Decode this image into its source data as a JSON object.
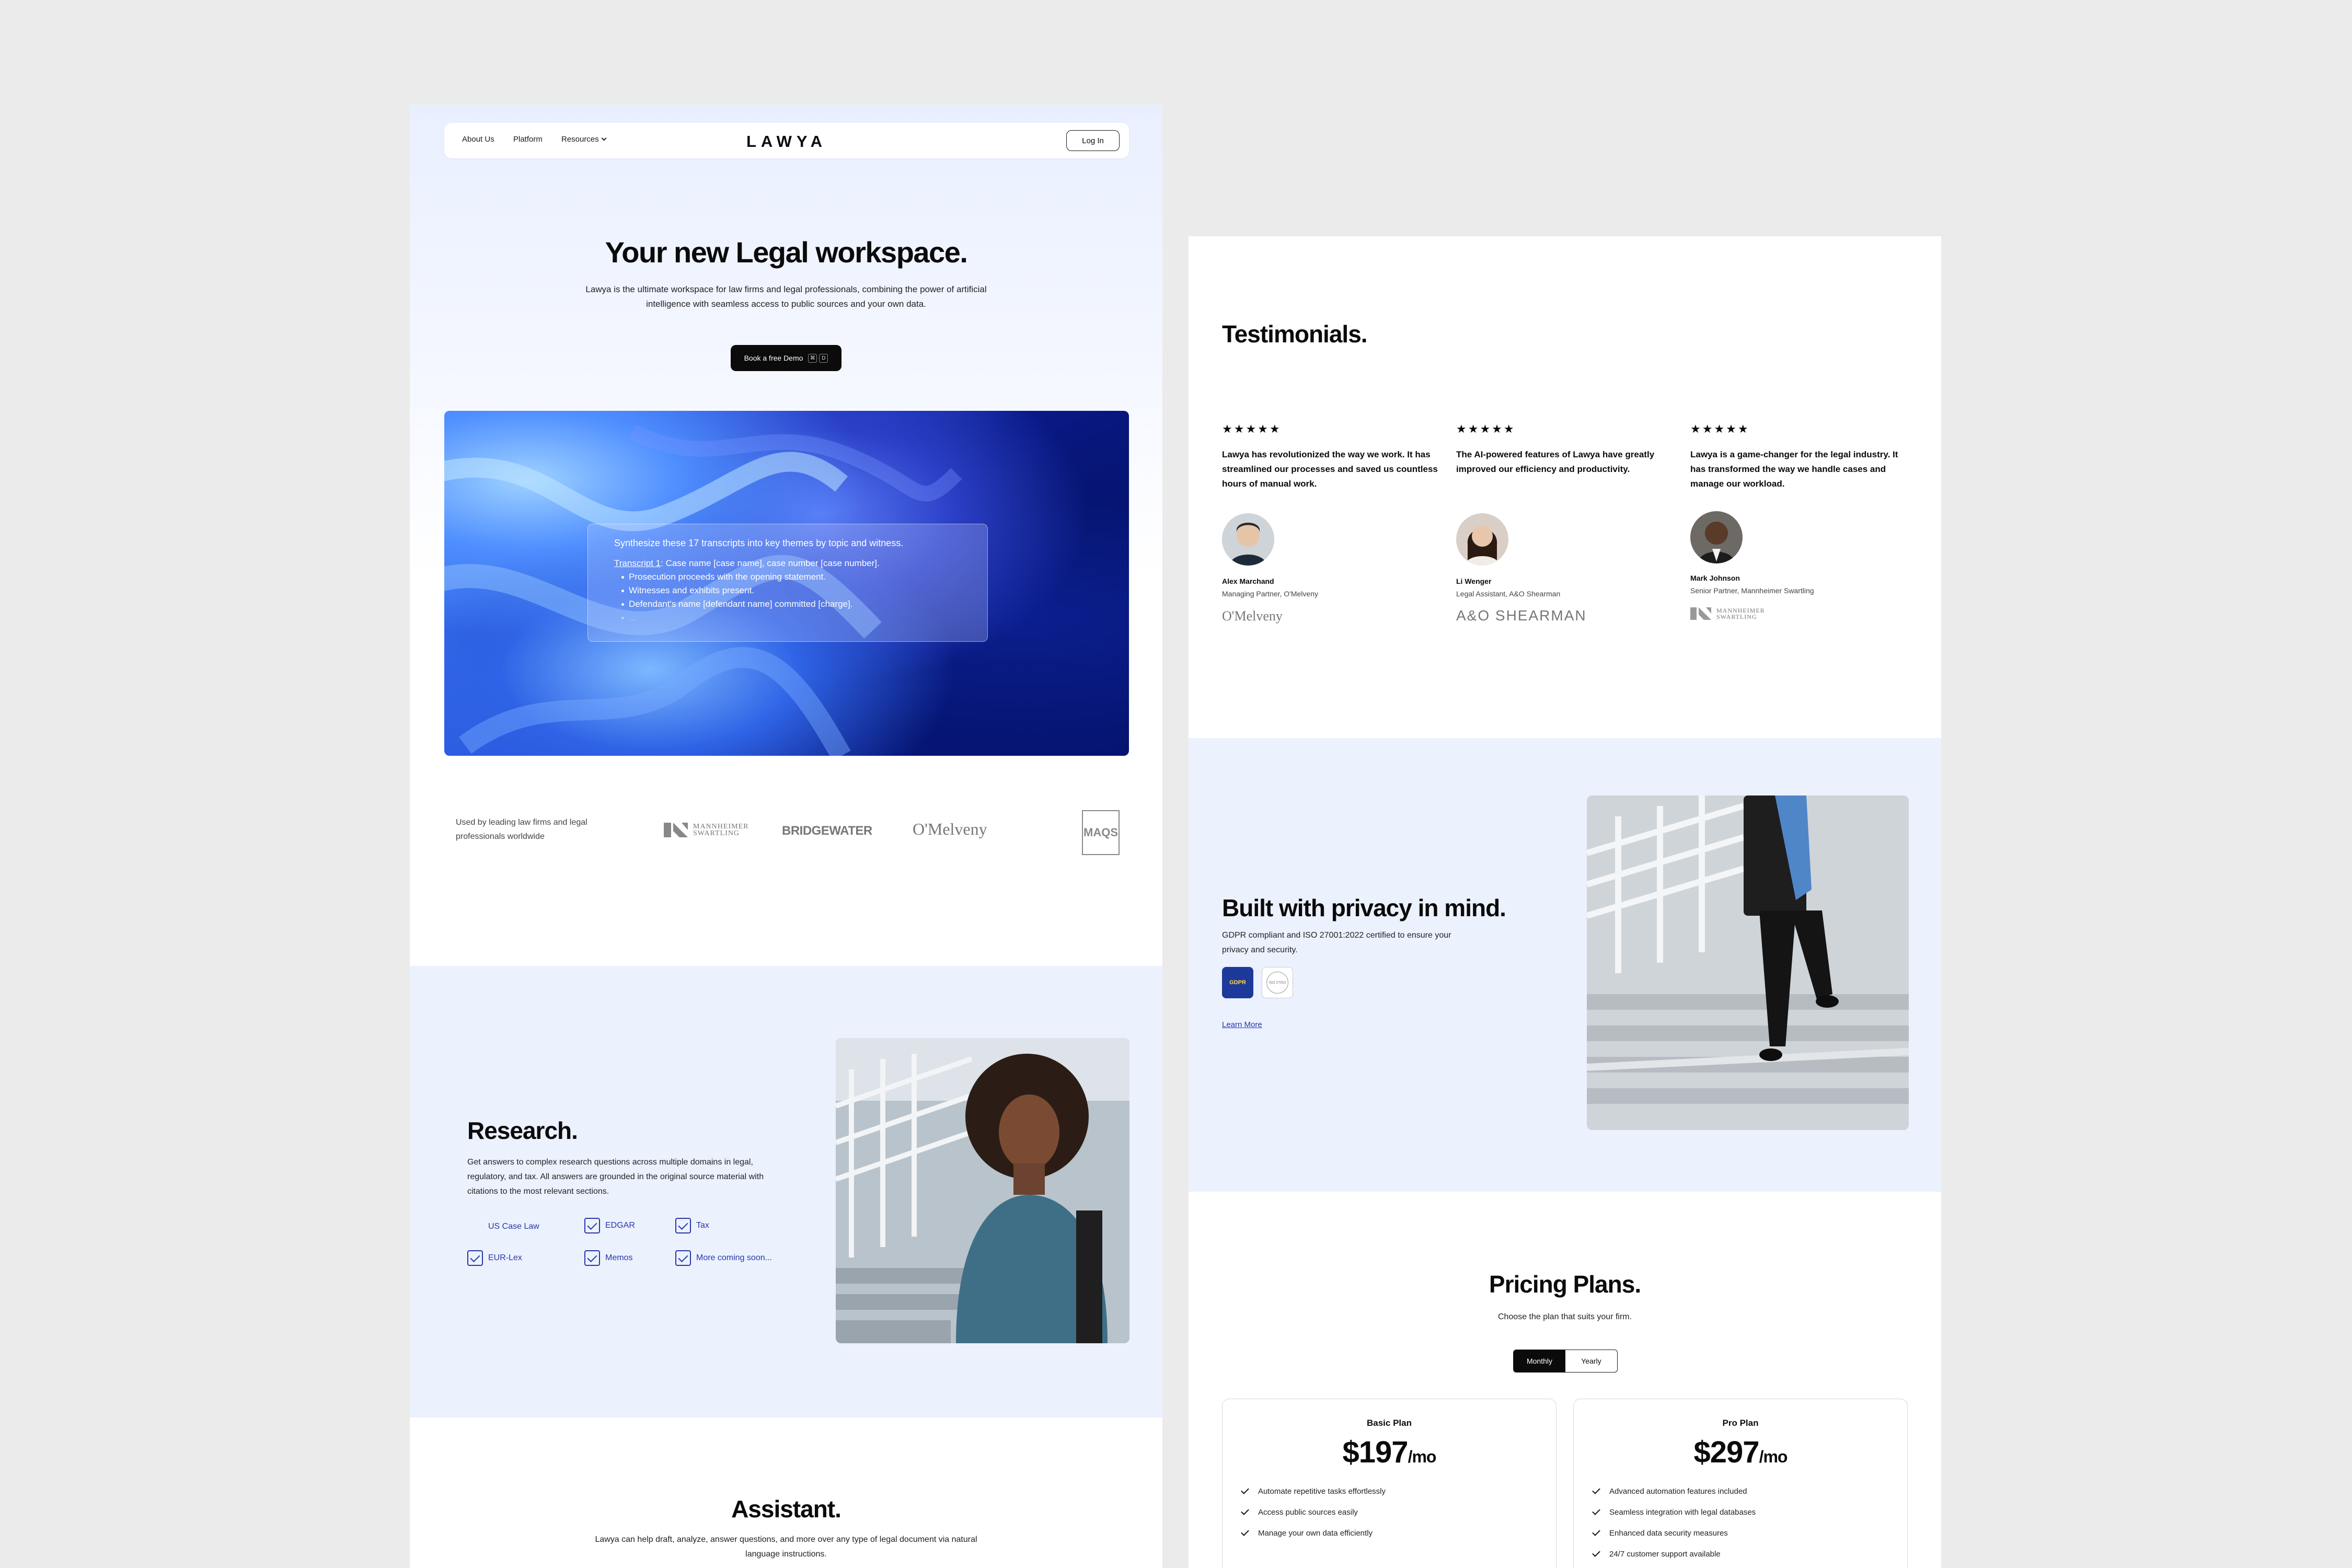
{
  "nav": {
    "links": [
      "About Us",
      "Platform",
      "Resources"
    ],
    "logo": "LAWYA",
    "login": "Log In"
  },
  "hero": {
    "title": "Your new Legal workspace.",
    "subtitle": "Lawya is the ultimate workspace for law firms and legal professionals, combining the power of artificial intelligence with seamless access to public sources and your own data.",
    "cta": "Book a free Demo",
    "cta_keys": [
      "⌘",
      "D"
    ]
  },
  "prompt": {
    "question": "Synthesize these 17 transcripts into key themes by topic and witness.",
    "transcript_link": "Transcript 1",
    "transcript_rest": ": Case name [case name], case number [case number].",
    "bullets": [
      "Prosecution proceeds with the opening statement.",
      "Witnesses and exhibits present.",
      "Defendant's name [defendant name] committed [charge].",
      "..."
    ]
  },
  "partners": {
    "caption": "Used by leading law firms and legal professionals worldwide",
    "logos": [
      "MANNHEIMER SWARTLING",
      "BRIDGEWATER",
      "O'Melveny",
      "MAQS"
    ]
  },
  "research": {
    "title": "Research.",
    "text": "Get answers to complex research questions across multiple domains in legal, regulatory, and tax. All answers are grounded in the original source material with citations to the most relevant sections.",
    "sources": [
      "US Case Law",
      "EDGAR",
      "Tax",
      "EUR-Lex",
      "Memos",
      "More coming soon..."
    ]
  },
  "assistant": {
    "title": "Assistant.",
    "text": "Lawya can help draft, analyze, answer questions, and more over any type of legal document via natural language instructions."
  },
  "testimonials": {
    "title": "Testimonials.",
    "items": [
      {
        "stars": "★★★★★",
        "quote": "Lawya has revolutionized the way we work. It has streamlined our processes and saved us countless hours of manual work.",
        "name": "Alex Marchand",
        "role": "Managing Partner, O'Melveny",
        "firm": "O'Melveny"
      },
      {
        "stars": "★★★★★",
        "quote": "The AI-powered features of Lawya have greatly improved our efficiency and productivity.",
        "name": "Li Wenger",
        "role": "Legal Assistant, A&O Shearman",
        "firm": "A&O SHEARMAN"
      },
      {
        "stars": "★★★★★",
        "quote": "Lawya is a game-changer for the legal industry. It has transformed the way we handle cases and manage our workload.",
        "name": "Mark Johnson",
        "role": "Senior Partner, Mannheimer Swartling",
        "firm": "MANNHEIMER SWARTLING"
      }
    ]
  },
  "privacy": {
    "title": "Built with privacy in mind.",
    "text": "GDPR compliant and ISO 27001:2022 certified to ensure your privacy and security.",
    "gdpr_badge": "GDPR",
    "iso_badge": "ISO 27001",
    "learn_more": "Learn More"
  },
  "pricing": {
    "title": "Pricing Plans.",
    "subtitle": "Choose the plan that suits your firm.",
    "toggle": [
      "Monthly",
      "Yearly"
    ],
    "per": "/mo",
    "plans": [
      {
        "name": "Basic Plan",
        "price": "$197",
        "features": [
          "Automate repetitive tasks effortlessly",
          "Access public sources easily",
          "Manage your own data efficiently"
        ]
      },
      {
        "name": "Pro Plan",
        "price": "$297",
        "features": [
          "Advanced automation features included",
          "Seamless integration with legal databases",
          "Enhanced data security measures",
          "24/7 customer support available"
        ]
      }
    ]
  },
  "colors": {
    "accent": "#2538a8",
    "hero_bg": "#e9efff",
    "section_bg": "#ecf1fe",
    "dark": "#0b0b0b"
  }
}
